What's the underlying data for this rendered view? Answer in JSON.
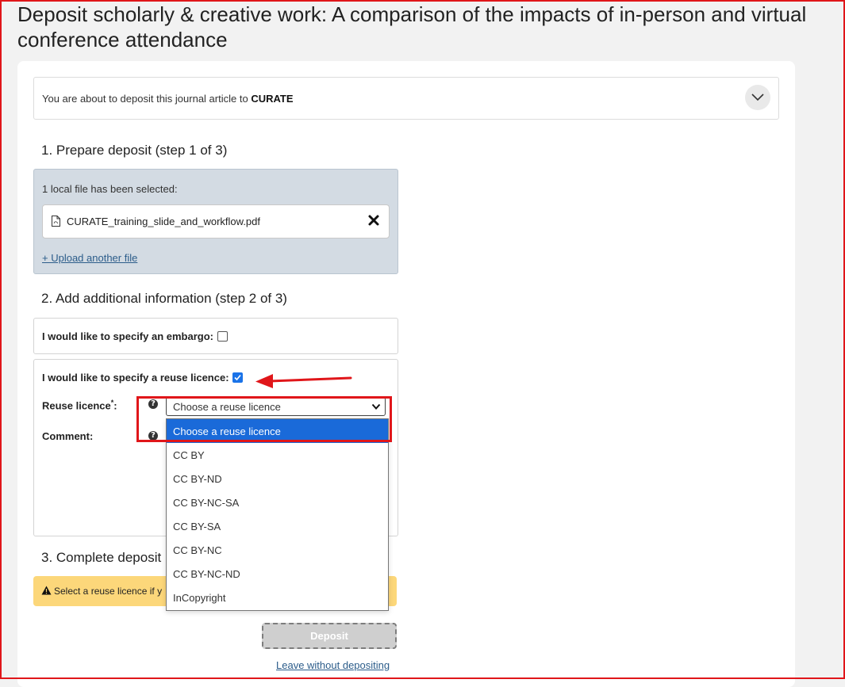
{
  "page": {
    "title": "Deposit scholarly & creative work: A comparison of the impacts of in-person and virtual conference attendance"
  },
  "info": {
    "prefix": "You are about to deposit this journal article to ",
    "repository": "CURATE"
  },
  "steps": {
    "step1": "1. Prepare deposit (step 1 of 3)",
    "step2": "2. Add additional information (step 2 of 3)",
    "step3": "3. Complete deposit"
  },
  "files": {
    "count_text": "1 local file has been selected:",
    "items": [
      {
        "name": "CURATE_training_slide_and_workflow.pdf",
        "icon": "pdf-file-icon"
      }
    ],
    "upload_link": "+ Upload another file"
  },
  "embargo": {
    "label": "I would like to specify an embargo:",
    "checked": false
  },
  "licence": {
    "checkbox_label": "I would like to specify a reuse licence:",
    "checked": true,
    "field_label": "Reuse licence",
    "required_mark": "*",
    "colon": ":",
    "select_value": "Choose a reuse licence",
    "comment_label": "Comment:",
    "help_glyph": "?",
    "options": [
      "Choose a reuse licence",
      "CC BY",
      "CC BY-ND",
      "CC BY-NC-SA",
      "CC BY-SA",
      "CC BY-NC",
      "CC BY-NC-ND",
      "InCopyright"
    ],
    "selected_index": 0
  },
  "warning": {
    "text": "Select a reuse licence if y",
    "icon": "warning-triangle-icon"
  },
  "actions": {
    "deposit": "Deposit",
    "leave": "Leave without depositing"
  },
  "colors": {
    "highlight": "#e0161a",
    "selected_option": "#1a6ad9",
    "file_panel": "#d3dbe3",
    "warning": "#fcd77a",
    "link": "#2b5c8a"
  }
}
